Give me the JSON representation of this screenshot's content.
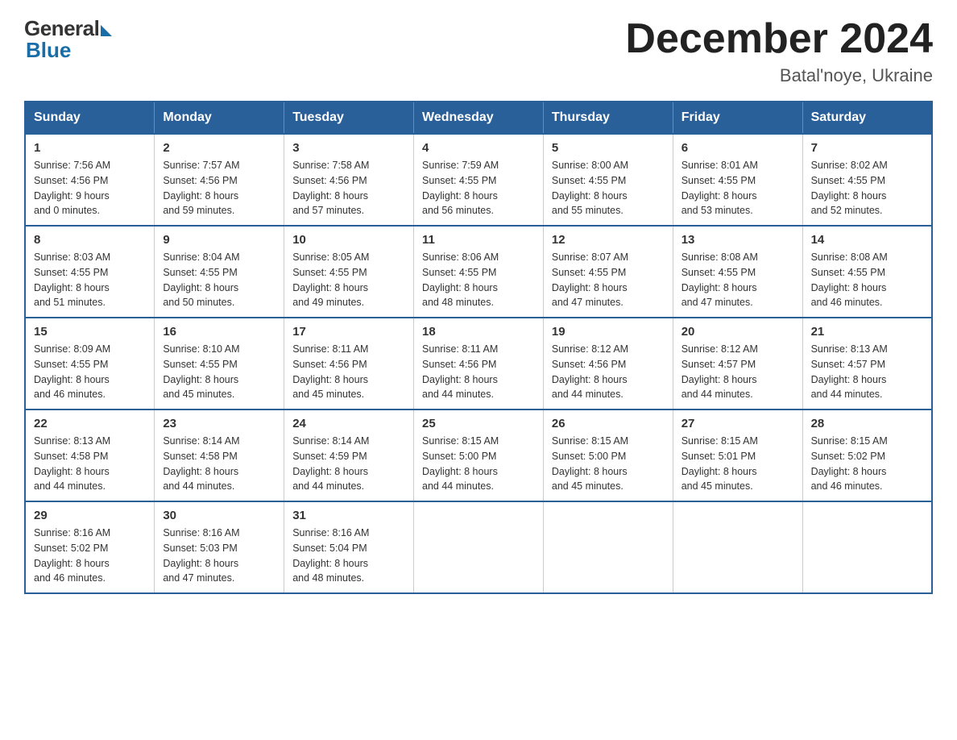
{
  "logo": {
    "general": "General",
    "blue": "Blue"
  },
  "header": {
    "month": "December 2024",
    "location": "Batal'noye, Ukraine"
  },
  "days_of_week": [
    "Sunday",
    "Monday",
    "Tuesday",
    "Wednesday",
    "Thursday",
    "Friday",
    "Saturday"
  ],
  "weeks": [
    [
      {
        "day": "1",
        "info": "Sunrise: 7:56 AM\nSunset: 4:56 PM\nDaylight: 9 hours\nand 0 minutes."
      },
      {
        "day": "2",
        "info": "Sunrise: 7:57 AM\nSunset: 4:56 PM\nDaylight: 8 hours\nand 59 minutes."
      },
      {
        "day": "3",
        "info": "Sunrise: 7:58 AM\nSunset: 4:56 PM\nDaylight: 8 hours\nand 57 minutes."
      },
      {
        "day": "4",
        "info": "Sunrise: 7:59 AM\nSunset: 4:55 PM\nDaylight: 8 hours\nand 56 minutes."
      },
      {
        "day": "5",
        "info": "Sunrise: 8:00 AM\nSunset: 4:55 PM\nDaylight: 8 hours\nand 55 minutes."
      },
      {
        "day": "6",
        "info": "Sunrise: 8:01 AM\nSunset: 4:55 PM\nDaylight: 8 hours\nand 53 minutes."
      },
      {
        "day": "7",
        "info": "Sunrise: 8:02 AM\nSunset: 4:55 PM\nDaylight: 8 hours\nand 52 minutes."
      }
    ],
    [
      {
        "day": "8",
        "info": "Sunrise: 8:03 AM\nSunset: 4:55 PM\nDaylight: 8 hours\nand 51 minutes."
      },
      {
        "day": "9",
        "info": "Sunrise: 8:04 AM\nSunset: 4:55 PM\nDaylight: 8 hours\nand 50 minutes."
      },
      {
        "day": "10",
        "info": "Sunrise: 8:05 AM\nSunset: 4:55 PM\nDaylight: 8 hours\nand 49 minutes."
      },
      {
        "day": "11",
        "info": "Sunrise: 8:06 AM\nSunset: 4:55 PM\nDaylight: 8 hours\nand 48 minutes."
      },
      {
        "day": "12",
        "info": "Sunrise: 8:07 AM\nSunset: 4:55 PM\nDaylight: 8 hours\nand 47 minutes."
      },
      {
        "day": "13",
        "info": "Sunrise: 8:08 AM\nSunset: 4:55 PM\nDaylight: 8 hours\nand 47 minutes."
      },
      {
        "day": "14",
        "info": "Sunrise: 8:08 AM\nSunset: 4:55 PM\nDaylight: 8 hours\nand 46 minutes."
      }
    ],
    [
      {
        "day": "15",
        "info": "Sunrise: 8:09 AM\nSunset: 4:55 PM\nDaylight: 8 hours\nand 46 minutes."
      },
      {
        "day": "16",
        "info": "Sunrise: 8:10 AM\nSunset: 4:55 PM\nDaylight: 8 hours\nand 45 minutes."
      },
      {
        "day": "17",
        "info": "Sunrise: 8:11 AM\nSunset: 4:56 PM\nDaylight: 8 hours\nand 45 minutes."
      },
      {
        "day": "18",
        "info": "Sunrise: 8:11 AM\nSunset: 4:56 PM\nDaylight: 8 hours\nand 44 minutes."
      },
      {
        "day": "19",
        "info": "Sunrise: 8:12 AM\nSunset: 4:56 PM\nDaylight: 8 hours\nand 44 minutes."
      },
      {
        "day": "20",
        "info": "Sunrise: 8:12 AM\nSunset: 4:57 PM\nDaylight: 8 hours\nand 44 minutes."
      },
      {
        "day": "21",
        "info": "Sunrise: 8:13 AM\nSunset: 4:57 PM\nDaylight: 8 hours\nand 44 minutes."
      }
    ],
    [
      {
        "day": "22",
        "info": "Sunrise: 8:13 AM\nSunset: 4:58 PM\nDaylight: 8 hours\nand 44 minutes."
      },
      {
        "day": "23",
        "info": "Sunrise: 8:14 AM\nSunset: 4:58 PM\nDaylight: 8 hours\nand 44 minutes."
      },
      {
        "day": "24",
        "info": "Sunrise: 8:14 AM\nSunset: 4:59 PM\nDaylight: 8 hours\nand 44 minutes."
      },
      {
        "day": "25",
        "info": "Sunrise: 8:15 AM\nSunset: 5:00 PM\nDaylight: 8 hours\nand 44 minutes."
      },
      {
        "day": "26",
        "info": "Sunrise: 8:15 AM\nSunset: 5:00 PM\nDaylight: 8 hours\nand 45 minutes."
      },
      {
        "day": "27",
        "info": "Sunrise: 8:15 AM\nSunset: 5:01 PM\nDaylight: 8 hours\nand 45 minutes."
      },
      {
        "day": "28",
        "info": "Sunrise: 8:15 AM\nSunset: 5:02 PM\nDaylight: 8 hours\nand 46 minutes."
      }
    ],
    [
      {
        "day": "29",
        "info": "Sunrise: 8:16 AM\nSunset: 5:02 PM\nDaylight: 8 hours\nand 46 minutes."
      },
      {
        "day": "30",
        "info": "Sunrise: 8:16 AM\nSunset: 5:03 PM\nDaylight: 8 hours\nand 47 minutes."
      },
      {
        "day": "31",
        "info": "Sunrise: 8:16 AM\nSunset: 5:04 PM\nDaylight: 8 hours\nand 48 minutes."
      },
      {
        "day": "",
        "info": ""
      },
      {
        "day": "",
        "info": ""
      },
      {
        "day": "",
        "info": ""
      },
      {
        "day": "",
        "info": ""
      }
    ]
  ]
}
